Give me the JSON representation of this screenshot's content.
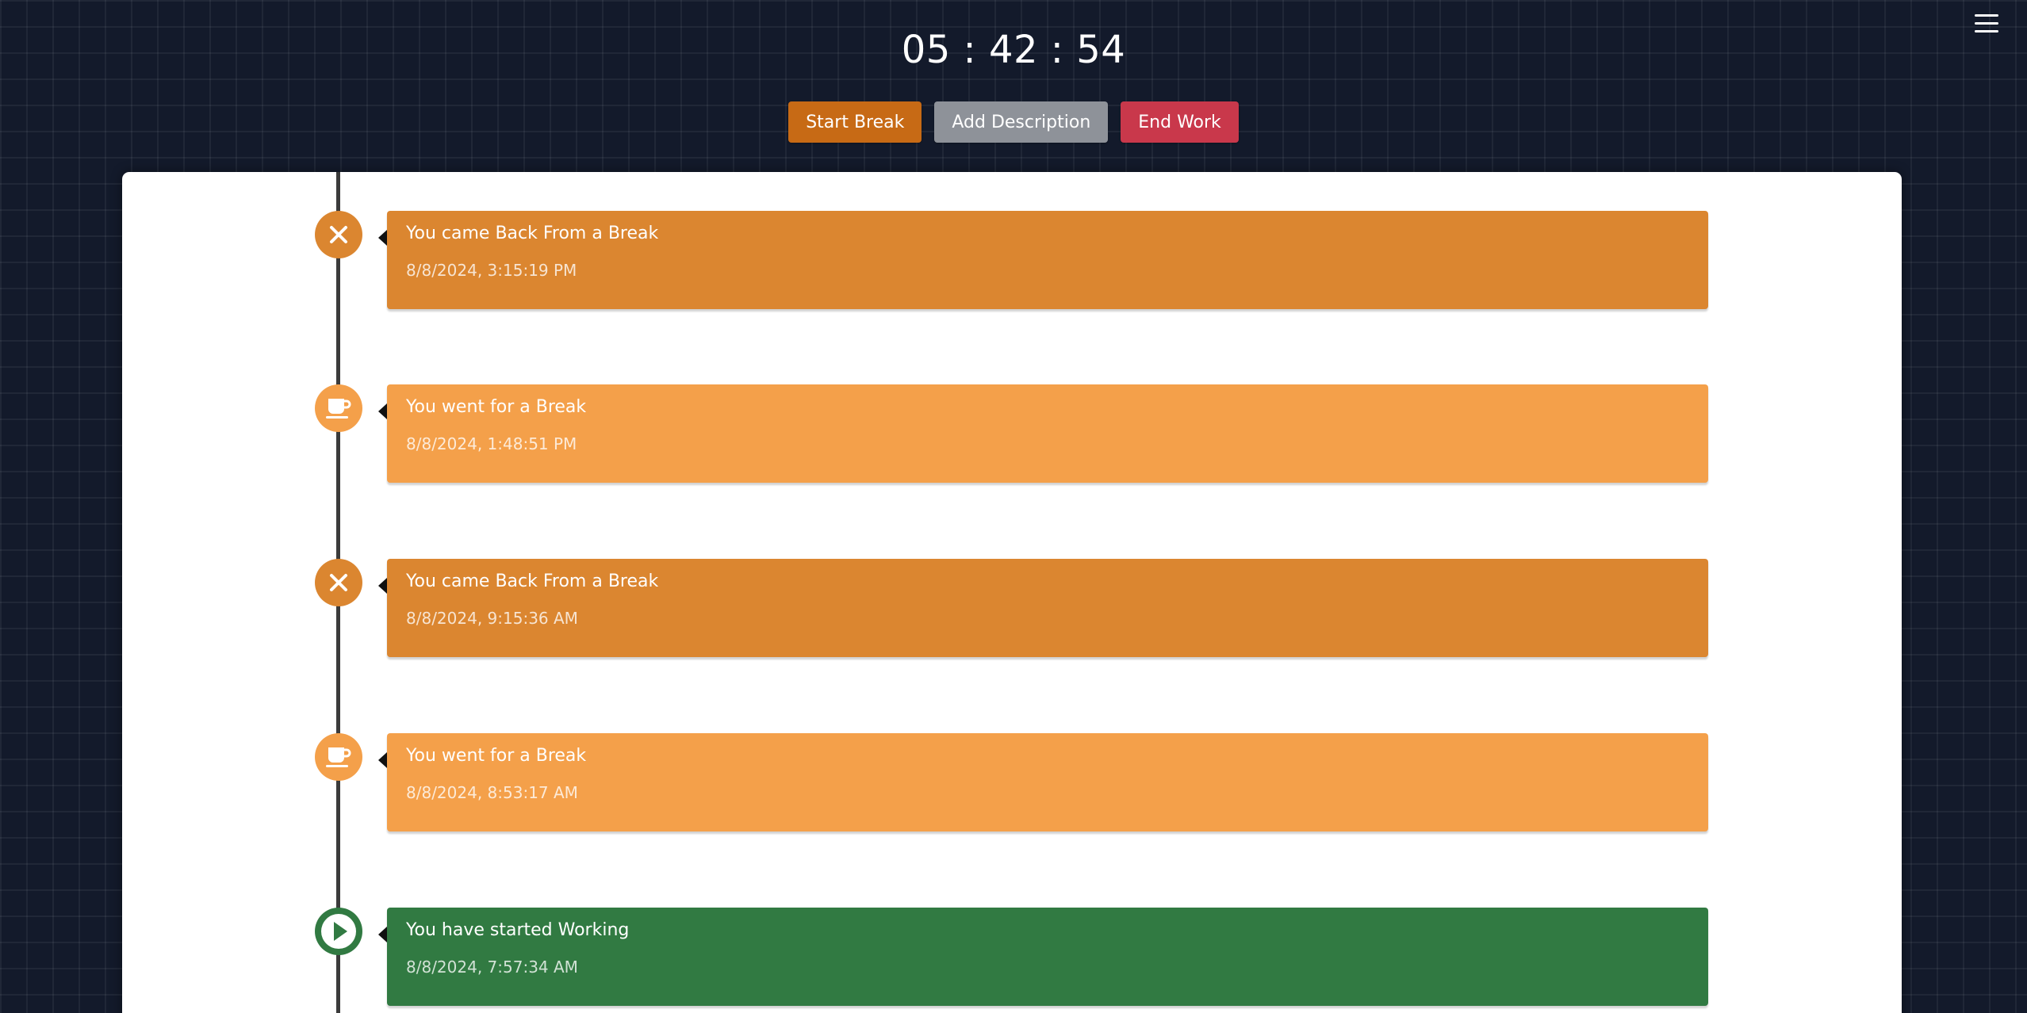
{
  "timer": {
    "display": "05 : 42 : 54"
  },
  "actions": {
    "start_break": "Start Break",
    "add_description": "Add Description",
    "end_work": "End Work"
  },
  "colors": {
    "start_break": "#c76a15",
    "add_description": "#8e9299",
    "end_work": "#c9384b",
    "break_return": "#db8630",
    "break_start": "#f4a04a",
    "work_start": "#317a42"
  },
  "timeline": [
    {
      "title": "You came Back From a Break",
      "time": "8/8/2024, 3:15:19 PM",
      "icon": "close-icon"
    },
    {
      "title": "You went for a Break",
      "time": "8/8/2024, 1:48:51 PM",
      "icon": "coffee-cup-icon"
    },
    {
      "title": "You came Back From a Break",
      "time": "8/8/2024, 9:15:36 AM",
      "icon": "close-icon"
    },
    {
      "title": "You went for a Break",
      "time": "8/8/2024, 8:53:17 AM",
      "icon": "coffee-cup-icon"
    },
    {
      "title": "You have started Working",
      "time": "8/8/2024, 7:57:34 AM",
      "icon": "play-icon"
    }
  ]
}
